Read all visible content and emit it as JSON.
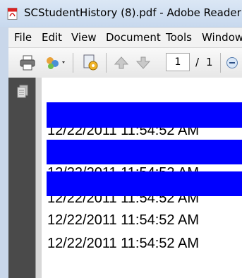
{
  "window": {
    "title": "SCStudentHistory (8).pdf - Adobe Reader"
  },
  "menu": [
    "File",
    "Edit",
    "View",
    "Document",
    "Tools",
    "Window"
  ],
  "toolbar": {
    "page_current": "1",
    "page_separator": "/",
    "page_total": "1",
    "icons": [
      "print-icon",
      "share-icon",
      "attach-gear-icon",
      "previous-page-icon",
      "next-page-icon",
      "zoom-out-icon"
    ]
  },
  "nav_panel": {
    "icons": [
      "pages-icon"
    ]
  },
  "document": {
    "lines": [
      "12/22/2011 11:54:52 AM",
      "12/22/2011 11:54:52 AM",
      "12/22/2011 11:54:52 AM",
      "12/22/2011 11:54:52 AM",
      "12/22/2011 11:54:52 AM"
    ],
    "highlight_color": "#0000ff"
  }
}
